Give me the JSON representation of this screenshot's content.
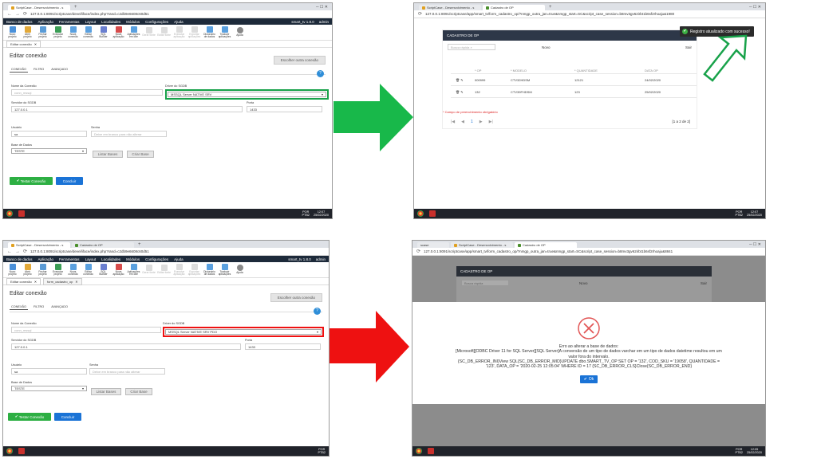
{
  "common": {
    "tab_scriptcase": "ScriptCase - Desenvolvimento - s",
    "tab_op": "Cadastro de OP",
    "url_edit": "127.0.0.1:8091/scriptcase/devel/iface/index.php?rand=c2db9e6608c60d51",
    "menu": [
      "Banco de dados",
      "Aplicação",
      "Ferramentas",
      "Layout",
      "Localidades",
      "Módulos",
      "Configurações",
      "Ajuda"
    ],
    "project": "smart_tv 1.8.0",
    "user": "admin",
    "tools": [
      "Novo projeto",
      "Abrir projeto",
      "Fechar projeto",
      "Executar projeto",
      "Nova conexão",
      "Editar conexão",
      "SQL Builder",
      "Nova aplicação",
      "Aplicações em lote",
      "Gerar fonte",
      "Editar fonte",
      "Executar aplicação",
      "Exportar aplicações",
      "Dicionário de dados",
      "Traduzir aplicações",
      "Ajuda"
    ],
    "subtab_edit": "Editar conexão",
    "page_title": "Editar conexão",
    "choose_btn": "Escolher outra conexão",
    "form_tabs": [
      "CONEXÃO",
      "FILTRO",
      "AVANÇADO"
    ],
    "lbl_name": "Nome da Conexão",
    "val_name": "conn_mssql",
    "lbl_driver": "Driver do SGDB",
    "lbl_server": "Servidor do SGDB",
    "val_server": "127.0.0.1",
    "lbl_port": "Porta",
    "val_port": "1433",
    "lbl_user": "Usuário",
    "val_user": "sa",
    "lbl_pass": "Senha",
    "ph_pass": "Deixe em branco para não alterar",
    "lbl_db": "Base de Dados",
    "val_db": "TESTE",
    "list_btn": "Listar Bases",
    "create_btn": "Criar Base",
    "test_btn": "Testar Conexão",
    "done_btn": "Concluir",
    "lang": "POR",
    "kbd": "PTB2",
    "op_title": "CADASTRO DE OP",
    "quick_search": "Busca rápida",
    "new_btn": "Novo",
    "exit_btn": "Sair"
  },
  "top_left": {
    "driver": "MSSQL Server NATIVE SRV",
    "time": "12:07",
    "date": "25/02/2020"
  },
  "bottom_left": {
    "driver": "MSSQL Server NATIVE SRV PDO",
    "subtab_2": "form_cadastro_op"
  },
  "top_right": {
    "url": "127.0.0.1:8091/scriptcase/app/smart_tv/form_cadastro_op/?nmgp_outra_jan=true&nmgp_start=SC&script_case_session=b8mv3gv62irbt1b6sf2rhoaju&1980",
    "toast": "Registro atualizado com sucesso!",
    "headers": [
      "* OP",
      "* MODELO",
      "* QUANTIDADE",
      "DATA OP"
    ],
    "rows": [
      [
        "000999",
        "CTV32HDSM",
        "12121",
        "24/02/2020"
      ],
      [
        "132",
        "CTV39FHDSM",
        "123",
        "25/02/2020"
      ]
    ],
    "required_note": "* Campo de preenchimento obrigatório",
    "page": "1",
    "paging": "[1 a 2 de 2]",
    "time": "12:07",
    "date": "25/02/2020"
  },
  "bottom_right": {
    "url": "127.0.0.1:8091/scriptcase/app/smart_tv/form_cadastro_op/?nmgp_outra_jan=true&nmgp_start=SC&script_case_session=b8mv3gv62irbt1b6sf2rhoaju&8841",
    "tab_first": "scase",
    "error_title": "Erro ao alterar a base de dados:",
    "error_1": "[Microsoft][ODBC Driver 11 for SQL Server][SQL Server]A conversão de um tipo de dados varchar em um tipo de dados datetime resultou em um",
    "error_2": "valor fora do intervalo.",
    "error_3": "{SC_DB_ERROR_INI}View SQL{SC_DB_ERROR_MID}UPDATE dbo.SMART_TV_OP SET OP = '132', COD_SKU = '19058', QUANTIDADE =",
    "error_4": "'123', DATA_OP = '2020-02-25 12:05:04' WHERE ID = 17 {SC_DB_ERROR_CLS}Close{SC_DB_ERROR_END}",
    "ok_btn": "Ok",
    "time": "12:05",
    "date": "25/02/2020"
  },
  "colors": {
    "success_arrow": "#18b84a",
    "error_arrow": "#ee1111",
    "toast_arrow_outline": "#18a24a"
  }
}
